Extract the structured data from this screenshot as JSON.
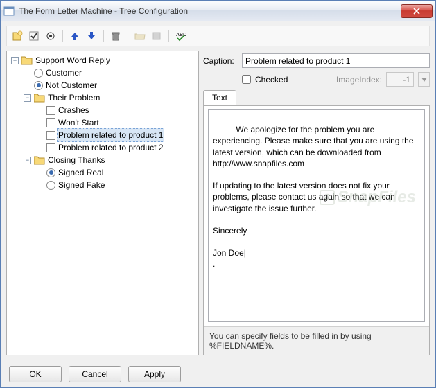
{
  "window": {
    "title": "The Form Letter Machine - Tree Configuration"
  },
  "toolbar": {
    "icons": {
      "new": "new-item-icon",
      "check": "check-icon",
      "target": "target-icon",
      "up": "arrow-up-icon",
      "down": "arrow-down-icon",
      "delete": "trash-icon",
      "folder_open": "folder-open-icon",
      "stop": "stop-icon",
      "spellcheck": "spellcheck-icon"
    }
  },
  "tree": {
    "root": {
      "label": "Support Word Reply",
      "children": [
        {
          "type": "radio",
          "label": "Customer",
          "selected": false
        },
        {
          "type": "radio",
          "label": "Not Customer",
          "selected": true
        },
        {
          "type": "folder",
          "label": "Their Problem",
          "expanded": true,
          "children": [
            {
              "type": "check",
              "label": "Crashes"
            },
            {
              "type": "check",
              "label": "Won't Start"
            },
            {
              "type": "check",
              "label": "Problem related to product 1",
              "current": true
            },
            {
              "type": "check",
              "label": "Problem related to product 2"
            }
          ]
        },
        {
          "type": "folder",
          "label": "Closing Thanks",
          "expanded": true,
          "children": [
            {
              "type": "radio",
              "label": "Signed Real",
              "selected": true
            },
            {
              "type": "radio",
              "label": "Signed Fake",
              "selected": false
            }
          ]
        }
      ]
    }
  },
  "editor": {
    "caption_label": "Caption:",
    "caption_value": "Problem related to product 1",
    "checked_label": "Checked",
    "checked": false,
    "imageindex_label": "ImageIndex:",
    "imageindex_value": "-1",
    "tab_label": "Text",
    "text": "We apologize for the problem you are experiencing. Please make sure that you are using the latest version, which can be downloaded from http://www.snapfiles.com\n\nIf updating to the latest version does not fix your problems, please contact us again so that we can  investigate the issue further.\n\nSincerely\n\nJon Doe|\n.",
    "hint": "You can specify fields to be filled in by using %FIELDNAME%."
  },
  "buttons": {
    "ok": "OK",
    "cancel": "Cancel",
    "apply": "Apply"
  },
  "watermark": "SnapFiles"
}
